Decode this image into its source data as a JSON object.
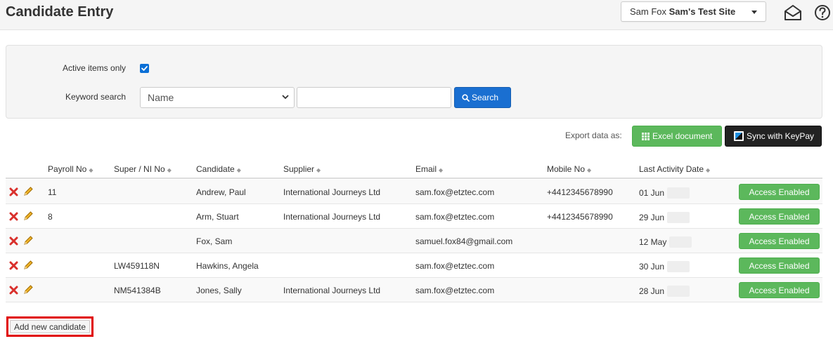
{
  "header": {
    "title": "Candidate Entry",
    "user_name": "Sam Fox",
    "site_name": "Sam's Test Site",
    "icons": [
      "envelope-open-icon",
      "help-circle-icon"
    ]
  },
  "filters": {
    "active_label": "Active items only",
    "active_checked": true,
    "keyword_label": "Keyword search",
    "field_selected": "Name",
    "search_value": "",
    "search_button": "Search"
  },
  "export": {
    "label": "Export data as:",
    "excel_button": "Excel document",
    "keypay_button": "Sync with KeyPay"
  },
  "table": {
    "columns": [
      "Payroll No",
      "Super / NI No",
      "Candidate",
      "Supplier",
      "Email",
      "Mobile No",
      "Last Activity Date"
    ],
    "rows": [
      {
        "payroll": "11",
        "super": "",
        "candidate": "Andrew, Paul",
        "supplier": "International Journeys Ltd",
        "email": "sam.fox@etztec.com",
        "mobile": "+4412345678990",
        "date": "01 Jun",
        "access": "Access Enabled"
      },
      {
        "payroll": "8",
        "super": "",
        "candidate": "Arm, Stuart",
        "supplier": "International Journeys Ltd",
        "email": "sam.fox@etztec.com",
        "mobile": "+4412345678990",
        "date": "29 Jun",
        "access": "Access Enabled"
      },
      {
        "payroll": "",
        "super": "",
        "candidate": "Fox, Sam",
        "supplier": "",
        "email": "samuel.fox84@gmail.com",
        "mobile": "",
        "date": "12 May",
        "access": "Access Enabled"
      },
      {
        "payroll": "",
        "super": "LW459118N",
        "candidate": "Hawkins, Angela",
        "supplier": "",
        "email": "sam.fox@etztec.com",
        "mobile": "",
        "date": "30 Jun",
        "access": "Access Enabled"
      },
      {
        "payroll": "",
        "super": "NM541384B",
        "candidate": "Jones, Sally",
        "supplier": "International Journeys Ltd",
        "email": "sam.fox@etztec.com",
        "mobile": "",
        "date": "28 Jun",
        "access": "Access Enabled"
      }
    ]
  },
  "add_button": "Add new candidate",
  "colors": {
    "primary_blue": "#1a6fd1",
    "success_green": "#5cb85c",
    "keypay_dark": "#222222",
    "delete_red": "#d9302c",
    "highlight_red": "#e00000"
  }
}
